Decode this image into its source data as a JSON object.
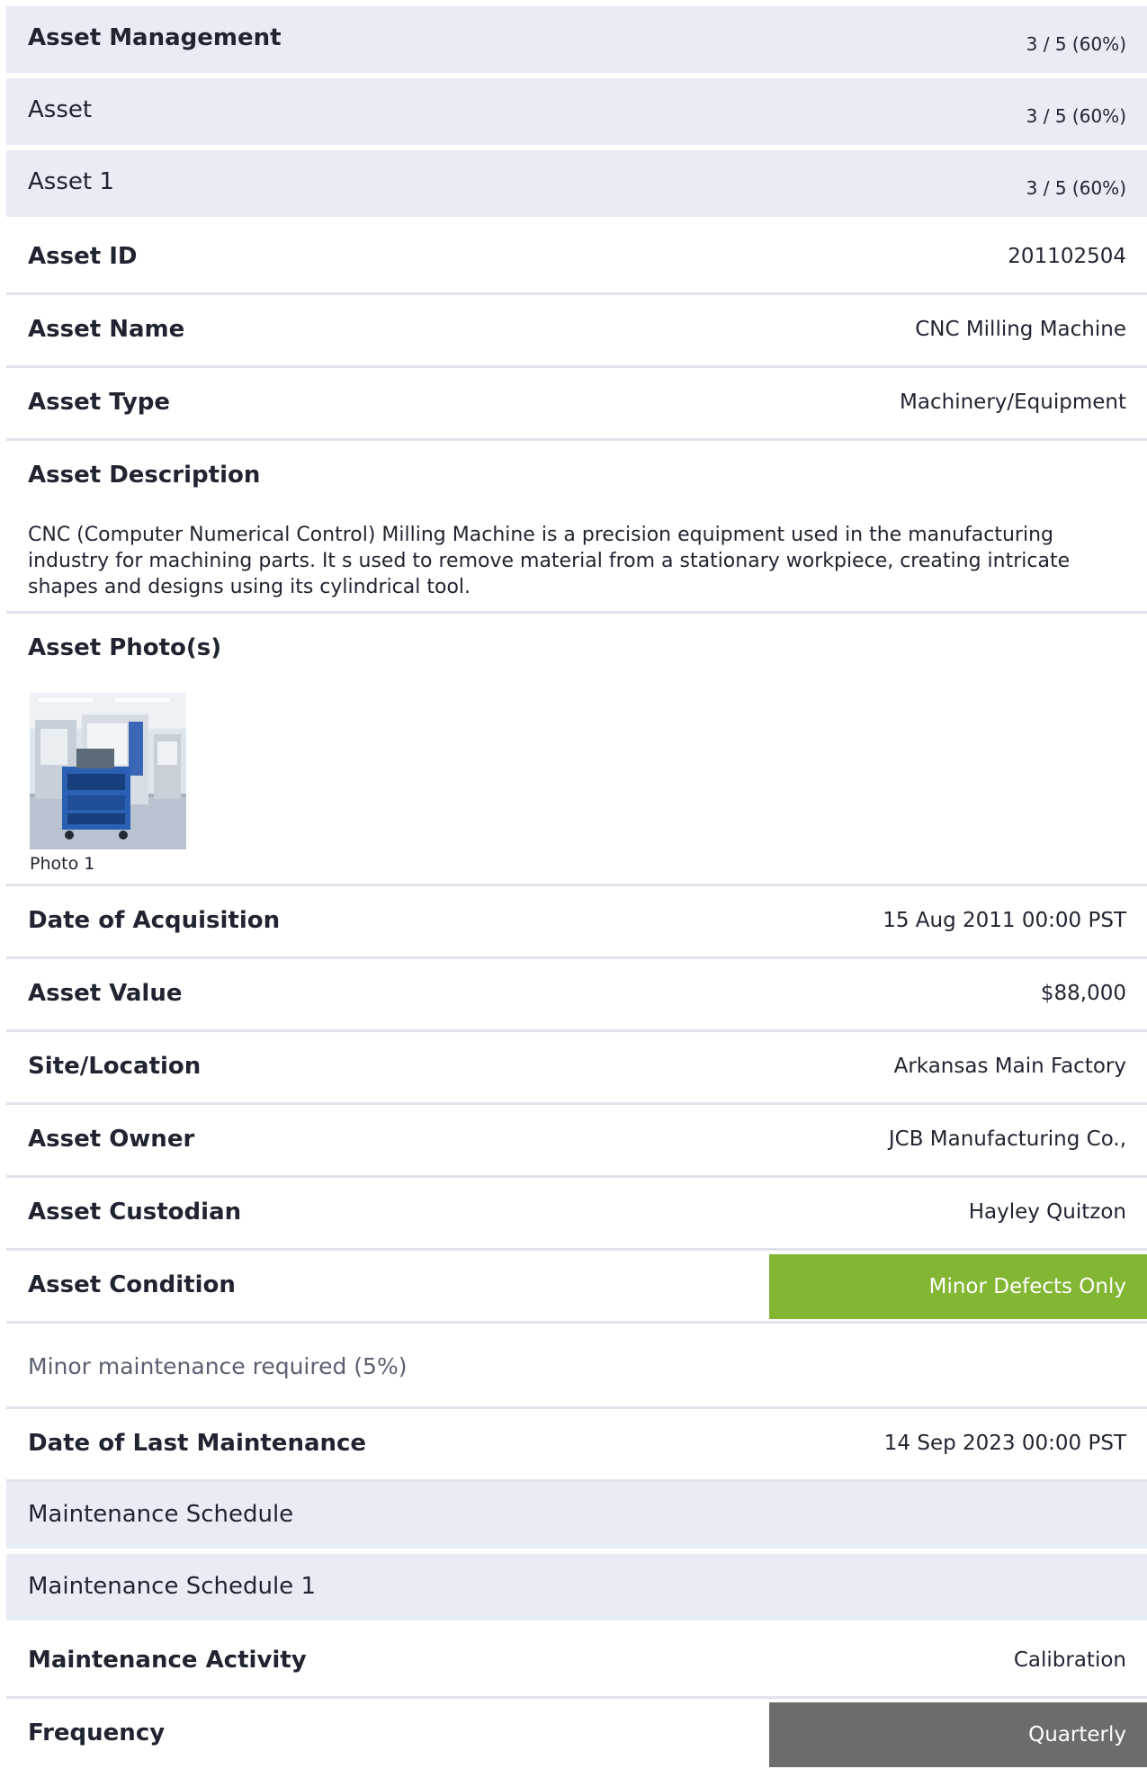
{
  "header": {
    "title": "Asset Management",
    "score": "3 / 5 (60%)"
  },
  "section": {
    "title": "Asset",
    "score": "3 / 5 (60%)"
  },
  "item": {
    "title": "Asset 1",
    "score": "3 / 5 (60%)"
  },
  "fields": {
    "asset_id": {
      "label": "Asset ID",
      "value": "201102504"
    },
    "asset_name": {
      "label": "Asset Name",
      "value": "CNC Milling Machine"
    },
    "asset_type": {
      "label": "Asset Type",
      "value": "Machinery/Equipment"
    },
    "asset_description": {
      "label": "Asset Description",
      "value": "CNC (Computer Numerical Control) Milling Machine is a precision equipment used in the manufacturing industry for machining parts. It s used to remove material from a stationary workpiece, creating intricate shapes and designs using its cylindrical tool."
    },
    "asset_photos": {
      "label": "Asset Photo(s)",
      "photos": [
        {
          "caption": "Photo 1"
        }
      ]
    },
    "date_of_acquisition": {
      "label": "Date of Acquisition",
      "value": "15 Aug 2011 00:00 PST"
    },
    "asset_value": {
      "label": "Asset Value",
      "value": "$88,000"
    },
    "site_location": {
      "label": "Site/Location",
      "value": "Arkansas Main Factory"
    },
    "asset_owner": {
      "label": "Asset Owner",
      "value": "JCB Manufacturing Co.,"
    },
    "asset_custodian": {
      "label": "Asset Custodian",
      "value": "Hayley Quitzon"
    },
    "asset_condition": {
      "label": "Asset Condition",
      "value": "Minor Defects Only",
      "color": "#82b633",
      "note": "Minor maintenance required (5%)"
    },
    "date_of_last_maintenance": {
      "label": "Date of Last Maintenance",
      "value": "14 Sep 2023 00:00 PST"
    }
  },
  "maintenance": {
    "section_title": "Maintenance Schedule",
    "item_title": "Maintenance Schedule 1",
    "activity": {
      "label": "Maintenance Activity",
      "value": "Calibration"
    },
    "frequency": {
      "label": "Frequency",
      "value": "Quarterly",
      "color": "#6c6c6c"
    }
  }
}
